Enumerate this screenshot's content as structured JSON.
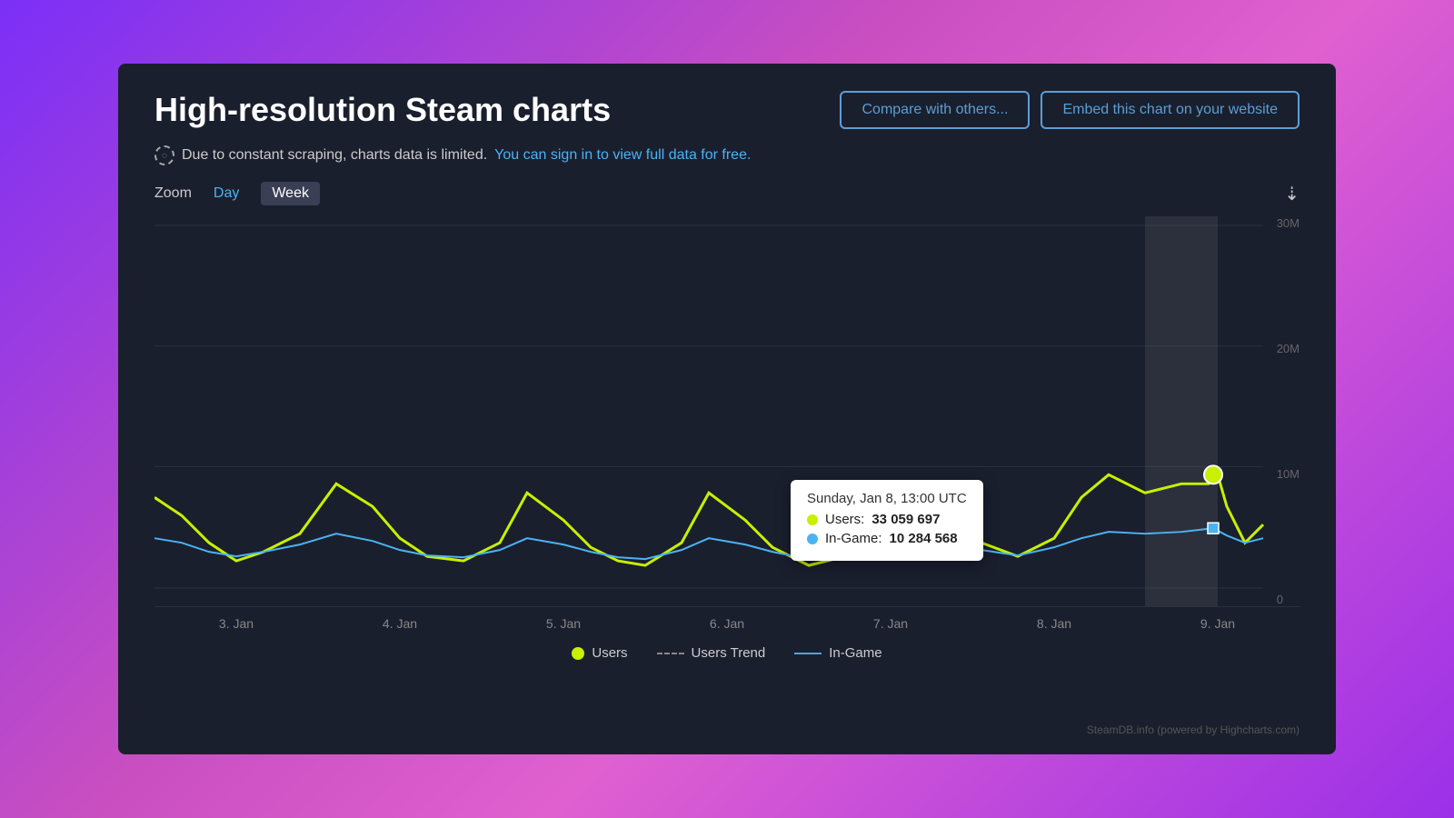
{
  "page": {
    "title": "High-resolution Steam charts",
    "buttons": {
      "compare": "Compare with others...",
      "embed": "Embed this chart on your website"
    },
    "notice": {
      "text": "Due to constant scraping, charts data is limited.",
      "link": "You can sign in to view full data for free."
    },
    "zoom": {
      "label": "Zoom",
      "day": "Day",
      "week": "Week",
      "active": "week"
    },
    "chart": {
      "y_labels": [
        "30M",
        "20M",
        "10M",
        "0"
      ],
      "x_labels": [
        "3. Jan",
        "4. Jan",
        "5. Jan",
        "6. Jan",
        "7. Jan",
        "8. Jan",
        "9. Jan"
      ]
    },
    "tooltip": {
      "title": "Sunday, Jan 8, 13:00 UTC",
      "users_label": "Users:",
      "users_value": "33 059 697",
      "ingame_label": "In-Game:",
      "ingame_value": "10 284 568"
    },
    "legend": {
      "users": "Users",
      "users_trend": "Users Trend",
      "ingame": "In-Game"
    },
    "watermark": "SteamDB.info (powered by Highcharts.com)"
  }
}
